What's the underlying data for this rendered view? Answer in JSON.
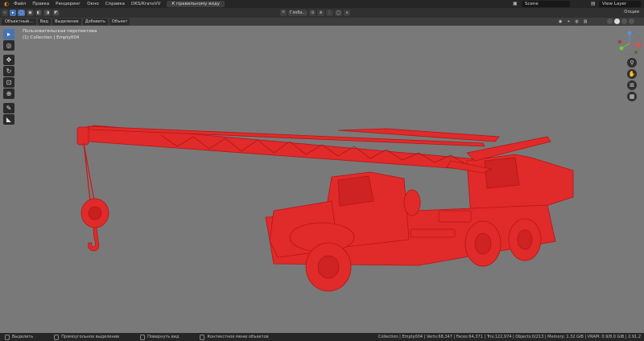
{
  "topbar": {
    "menu": [
      "Файл",
      "Правка",
      "Рендеринг",
      "Окно",
      "Справка"
    ],
    "project_tab": "DKS/KransVV",
    "workspace_tab": "К правильному виду",
    "scene_icon": "scene-icon",
    "scene_name": "Scene",
    "layer_icon": "view-layer-icon",
    "view_layer": "View Layer"
  },
  "header1": {
    "orientation": "Глоба...",
    "options": "Опции"
  },
  "header2": {
    "mode": "Объектный...",
    "menus": [
      "Вид",
      "Выделение",
      "Добавить",
      "Объект"
    ]
  },
  "viewport": {
    "perspective": "Пользовательская перспектива",
    "collection_line": "(1) Collection | Empty004",
    "background": "#797979",
    "model_color": "#e12a2a"
  },
  "toolbar": {
    "tools": [
      {
        "name": "select-box-tool",
        "glyph": "▸",
        "active": true
      },
      {
        "name": "cursor-tool",
        "glyph": "◎",
        "active": false
      },
      {
        "name": "move-tool",
        "glyph": "✥",
        "active": false
      },
      {
        "name": "rotate-tool",
        "glyph": "↻",
        "active": false
      },
      {
        "name": "scale-tool",
        "glyph": "⊡",
        "active": false
      },
      {
        "name": "transform-tool",
        "glyph": "⊕",
        "active": false
      },
      {
        "name": "annotate-tool",
        "glyph": "✎",
        "active": false
      },
      {
        "name": "measure-tool",
        "glyph": "◣",
        "active": false
      }
    ]
  },
  "gizmo": {
    "x_color": "#f04a4a",
    "y_color": "#7cc33b",
    "z_color": "#5b8de5"
  },
  "statusbar": {
    "hints": [
      "Выделить",
      "Прямоугольное выделение",
      "Повернуть вид",
      "Контекстное меню объектов"
    ],
    "stats": "Collection | Empty004 | Verts:68,347 | Faces:64,371 | Tris:122,974 | Objects:0/213 | Memory: 1.32 GiB | VRAM: 0.9/8.0 GiB | 2.91.2"
  }
}
